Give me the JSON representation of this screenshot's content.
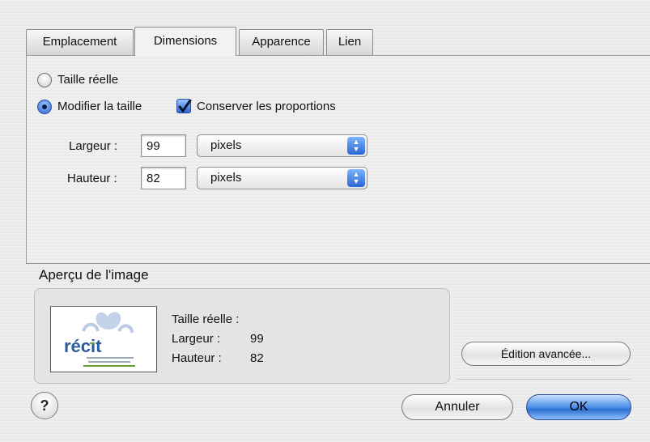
{
  "tabs": [
    {
      "label": "Emplacement",
      "active": false
    },
    {
      "label": "Dimensions",
      "active": true
    },
    {
      "label": "Apparence",
      "active": false
    },
    {
      "label": "Lien",
      "active": false
    }
  ],
  "dimensions": {
    "actual_size_label": "Taille réelle",
    "actual_size_selected": false,
    "modify_size_label": "Modifier la taille",
    "modify_size_selected": true,
    "keep_proportions_label": "Conserver les proportions",
    "keep_proportions_checked": true,
    "width_label": "Largeur :",
    "width_value": "99",
    "width_unit": "pixels",
    "height_label": "Hauteur :",
    "height_value": "82",
    "height_unit": "pixels"
  },
  "preview": {
    "title": "Aperçu de l'image",
    "info_title": "Taille réelle :",
    "width_label": "Largeur :",
    "width_value": "99",
    "height_label": "Hauteur :",
    "height_value": "82",
    "logo_text": "récit"
  },
  "buttons": {
    "advanced_edit": "Édition avancée...",
    "cancel": "Annuler",
    "ok": "OK",
    "help": "?"
  },
  "colors": {
    "accent": "#2a66d4",
    "logo_blue": "#2a5b9e",
    "logo_green": "#6a9e2e"
  }
}
